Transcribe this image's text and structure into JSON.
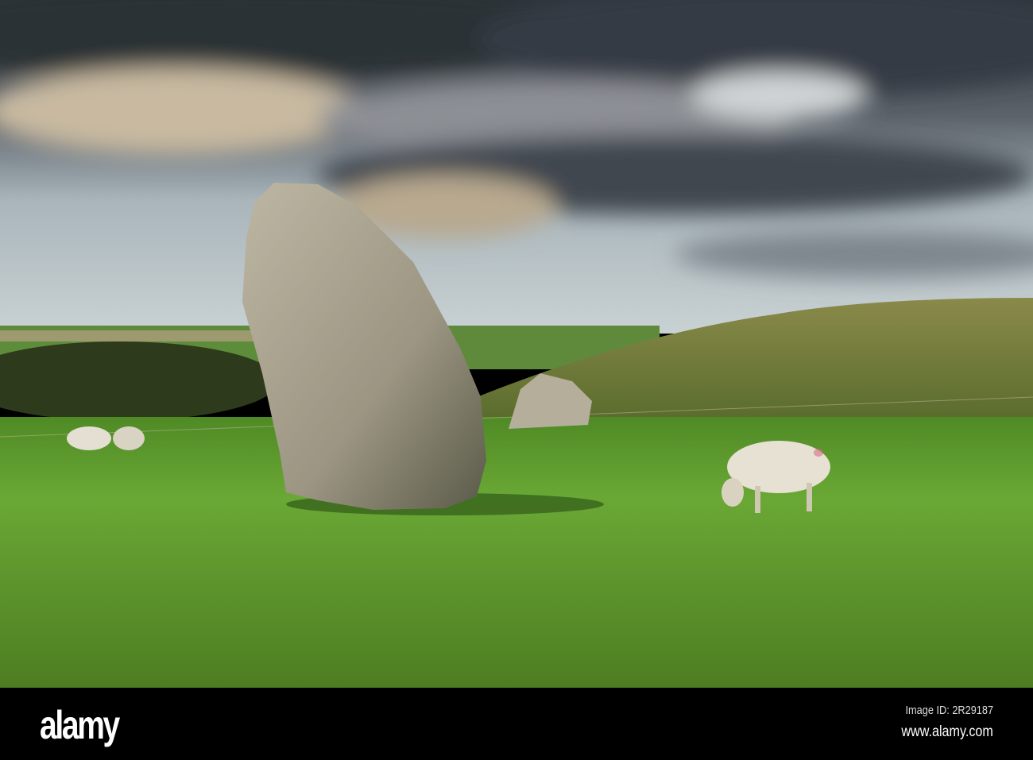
{
  "watermark": {
    "logo": "alamy"
  },
  "footer": {
    "image_id": "Image ID: 2R29187",
    "url": "www.alamy.com"
  },
  "colors": {
    "grass": "#5e9a2c",
    "sky": "#b7c4c8",
    "cloud": "#3e4650",
    "stone": "#a8a290"
  }
}
